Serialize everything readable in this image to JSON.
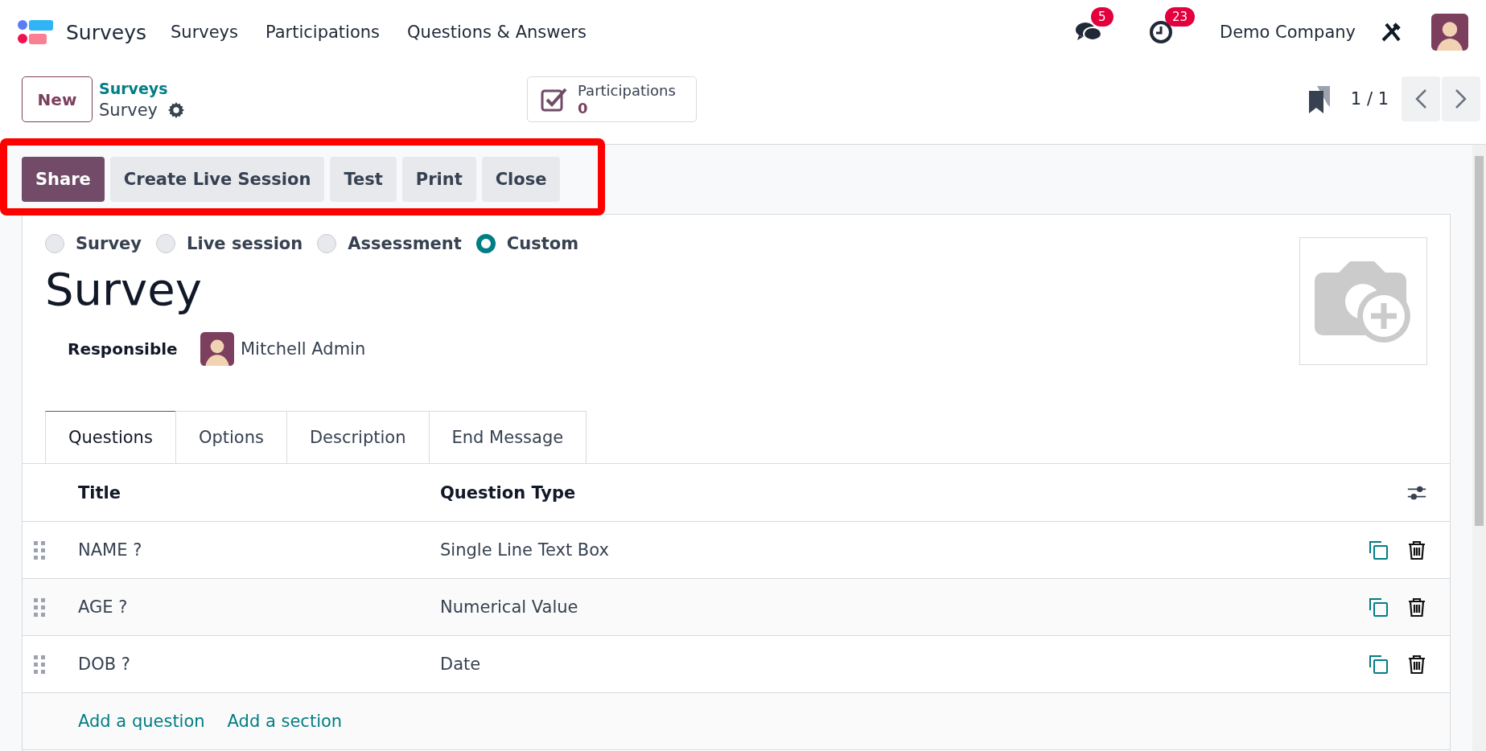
{
  "navbar": {
    "app_name": "Surveys",
    "menu": [
      "Surveys",
      "Participations",
      "Questions & Answers"
    ],
    "messages_badge": "5",
    "activities_badge": "23",
    "company": "Demo Company"
  },
  "control_panel": {
    "new_button": "New",
    "breadcrumb_parent": "Surveys",
    "breadcrumb_current": "Survey",
    "stat_button": {
      "label": "Participations",
      "value": "0"
    },
    "pager": "1 / 1"
  },
  "action_bar": {
    "highlighted": true,
    "buttons": [
      {
        "label": "Share",
        "kind": "primary"
      },
      {
        "label": "Create Live Session",
        "kind": "secondary"
      },
      {
        "label": "Test",
        "kind": "secondary"
      },
      {
        "label": "Print",
        "kind": "secondary"
      },
      {
        "label": "Close",
        "kind": "secondary"
      }
    ]
  },
  "form": {
    "survey_types": [
      {
        "label": "Survey",
        "selected": false
      },
      {
        "label": "Live session",
        "selected": false
      },
      {
        "label": "Assessment",
        "selected": false
      },
      {
        "label": "Custom",
        "selected": true
      }
    ],
    "title": "Survey",
    "responsible_label": "Responsible",
    "responsible": "Mitchell Admin",
    "tabs": [
      {
        "label": "Questions",
        "selected": true
      },
      {
        "label": "Options",
        "selected": false
      },
      {
        "label": "Description",
        "selected": false
      },
      {
        "label": "End Message",
        "selected": false
      }
    ],
    "table": {
      "columns": [
        "Title",
        "Question Type"
      ],
      "rows": [
        {
          "title": "NAME ?",
          "type": "Single Line Text Box"
        },
        {
          "title": "AGE ?",
          "type": "Numerical Value"
        },
        {
          "title": "DOB ?",
          "type": "Date"
        }
      ],
      "add_links": [
        "Add a question",
        "Add a section"
      ]
    }
  }
}
